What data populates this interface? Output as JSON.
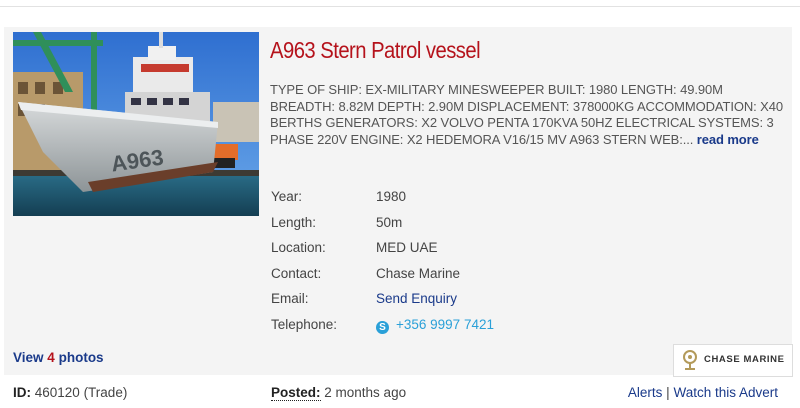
{
  "listing": {
    "title": "A963 Stern Patrol vessel",
    "description": "TYPE OF SHIP: EX-MILITARY MINESWEEPER BUILT: 1980 LENGTH: 49.90M BREADTH: 8.82M DEPTH: 2.90M DISPLACEMENT: 378000KG ACCOMMODATION: X40 BERTHS GENERATORS: X2 VOLVO PENTA 170KVA 50HZ ELECTRICAL SYSTEMS: 3 PHASE 220V ENGINE: X2 HEDEMORA V16/15 MV A963 STERN WEB:...",
    "read_more": "read more",
    "photo_hull_text": "A963",
    "specs": {
      "year_label": "Year:",
      "year": "1980",
      "length_label": "Length:",
      "length": "50m",
      "location_label": "Location:",
      "location": "MED UAE",
      "contact_label": "Contact:",
      "contact": "Chase Marine",
      "email_label": "Email:",
      "email": "Send Enquiry",
      "telephone_label": "Telephone:",
      "telephone": "+356 9997 7421"
    },
    "photos": {
      "prefix": "View",
      "count": "4",
      "suffix": "photos"
    },
    "seller_logo": "CHASE MARINE",
    "id_label": "ID:",
    "id_value": "460120 (Trade)",
    "posted_label": "Posted:",
    "posted_value": "2 months ago",
    "alerts": "Alerts",
    "separator": "|",
    "watch": "Watch this Advert"
  },
  "colors": {
    "title": "#b5121b",
    "link": "#1a3a8a",
    "phone": "#2aa0d8",
    "card_bg": "#f4f4f4"
  },
  "icons": {
    "telephone": "skype-icon",
    "logo": "ship-wheel-emblem-icon"
  }
}
